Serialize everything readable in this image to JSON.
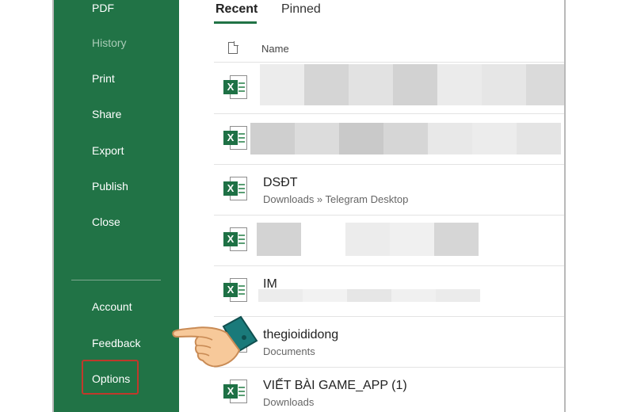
{
  "sidebar": {
    "items": [
      {
        "label": "PDF"
      },
      {
        "label": "History"
      },
      {
        "label": "Print"
      },
      {
        "label": "Share"
      },
      {
        "label": "Export"
      },
      {
        "label": "Publish"
      },
      {
        "label": "Close"
      },
      {
        "label": "Account"
      },
      {
        "label": "Feedback"
      },
      {
        "label": "Options"
      }
    ],
    "bg_color": "#217346"
  },
  "tabs": [
    {
      "label": "Recent"
    },
    {
      "label": "Pinned"
    }
  ],
  "list": {
    "column_header": "Name",
    "files": [
      {
        "name": "",
        "path": ""
      },
      {
        "name": "",
        "path": ""
      },
      {
        "name": "DSĐT",
        "path": "Downloads » Telegram Desktop"
      },
      {
        "name": "",
        "path": ""
      },
      {
        "name": "IM",
        "path": ""
      },
      {
        "name": "thegioididong",
        "path": "Documents"
      },
      {
        "name": "VIẾT BÀI GAME_APP (1)",
        "path": "Downloads"
      }
    ]
  },
  "icons": {
    "file_type": "excel-icon",
    "header": "document-icon",
    "pointer": "pointing-hand-icon"
  },
  "highlight_color": "#c0392b"
}
